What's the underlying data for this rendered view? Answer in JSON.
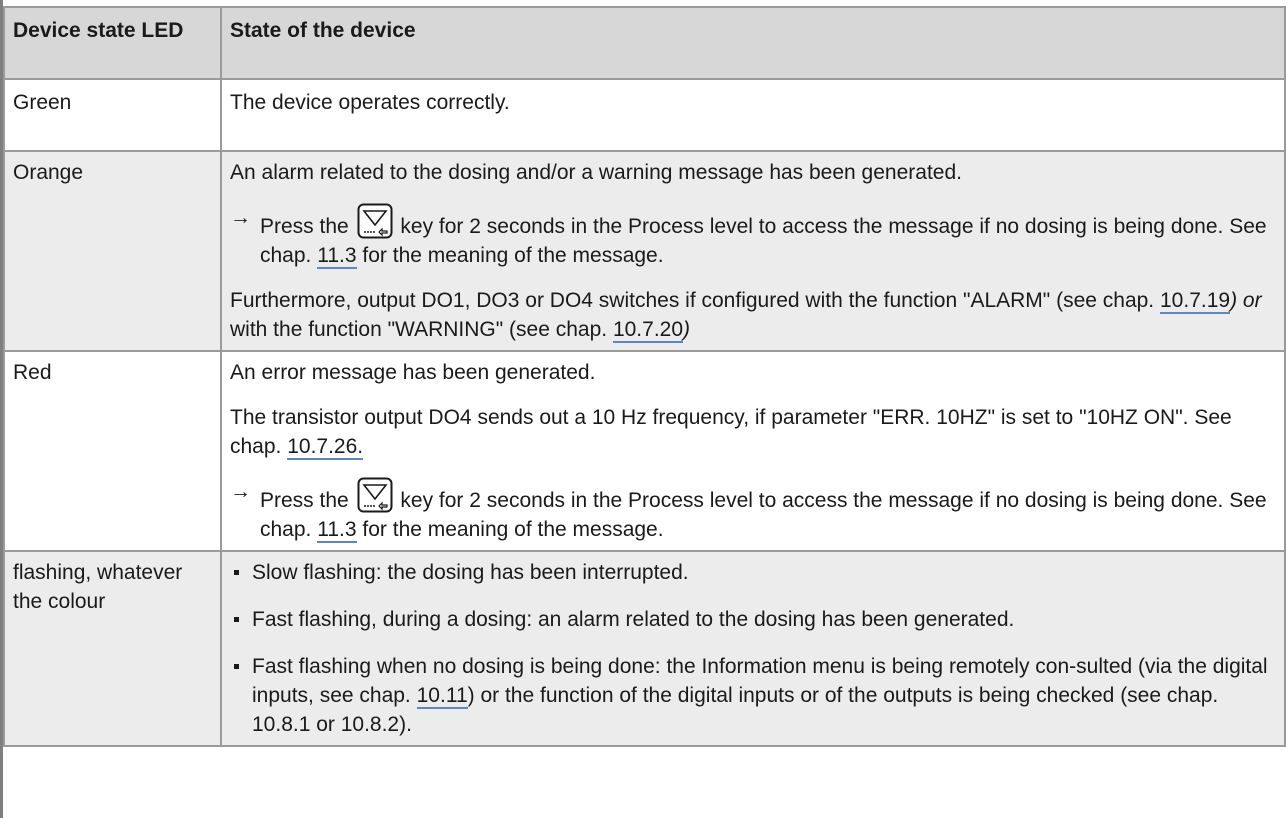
{
  "header": {
    "col1": "Device state LED",
    "col2": "State of the device"
  },
  "icon": {
    "name": "down-arrow-key-icon",
    "color": "#1a1a1a"
  },
  "link_color": "#5b87c7",
  "rows": {
    "green": {
      "label": "Green",
      "text": "The device operates correctly."
    },
    "orange": {
      "label": "Orange",
      "line1": "An alarm related to the dosing and/or a warning message has been generated.",
      "step_arrow": "→",
      "step_pre": "Press the",
      "step_post": "key for 2 seconds in the Process level to access the message if no dosing is being done. See chap.",
      "step_ref": "11.3",
      "step_tail": "for the meaning of the message.",
      "furth_pre": "Furthermore, output DO1, DO3 or DO4 switches if configured with the function \"ALARM\" (see chap.",
      "furth_ref1": "10.7.19",
      "furth_paren1": ")",
      "furth_or": "or",
      "furth_mid": "with the function \"WARNING\" (see chap.",
      "furth_ref2": "10.7.20",
      "furth_paren2": ")"
    },
    "red": {
      "label": "Red",
      "line1": "An error message has been generated.",
      "line2_pre": "The transistor output DO4 sends out a 10 Hz frequency, if parameter \"ERR. 10HZ\" is set to \"10HZ ON\". See chap.",
      "line2_ref": "10.7.26.",
      "step_arrow": "→",
      "step_pre": "Press the",
      "step_post": "key for 2 seconds in the Process level to access the message if no dosing is being done. See chap.",
      "step_ref": "11.3",
      "step_tail": "for the meaning of the message."
    },
    "flashing": {
      "label": "flashing, whatever the colour",
      "b1": "Slow flashing: the dosing has been interrupted.",
      "b2": "Fast flashing, during a dosing: an alarm related to the dosing has been generated.",
      "b3_pre": "Fast flashing when no dosing is being done: the Information menu is being remotely con-sulted (via the digital inputs, see chap.",
      "b3_ref": "10.11",
      "b3_post": ") or the function of the digital inputs or of the outputs is being checked (see chap. 10.8.1 or 10.8.2)."
    }
  }
}
